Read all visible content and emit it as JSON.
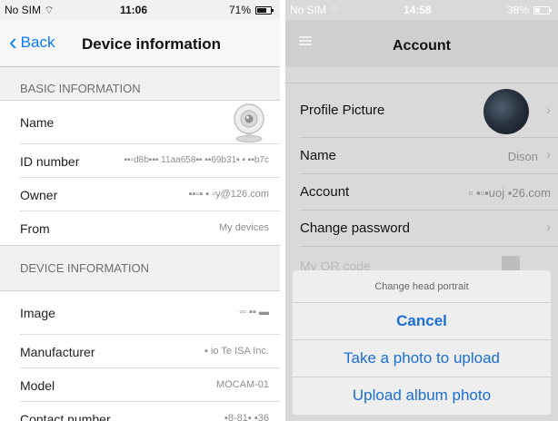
{
  "left": {
    "status": {
      "carrier": "No SIM",
      "time": "11:06",
      "battery_pct": "71%",
      "battery_level": 0.71
    },
    "nav": {
      "back_label": "Back",
      "title": "Device information"
    },
    "basic_header": "BASIC INFORMATION",
    "basic_rows": [
      {
        "label": "Name",
        "value": ""
      },
      {
        "label": "ID number",
        "value": "▪▪▫d8b▪▪▪ 11aa658▪▪ ▪▪69b31▪ ▪ ▪▪b7c"
      },
      {
        "label": "Owner",
        "value": "▪▪▫▪ ▪ ▫y@126.com"
      },
      {
        "label": "From",
        "value": "My devices"
      }
    ],
    "device_header": "DEVICE INFORMATION",
    "device_rows": [
      {
        "label": "Image",
        "value": "▫▫ ▪▪ ▬"
      },
      {
        "label": "Manufacturer",
        "value": "▪   io Te   ISA Inc."
      },
      {
        "label": "Model",
        "value": "MOCAM-01"
      },
      {
        "label": "Contact number",
        "value": "▪8-81▪ ▪36"
      }
    ]
  },
  "right": {
    "status": {
      "carrier": "No SIM",
      "time": "14:58",
      "battery_pct": "38%",
      "battery_level": 0.38
    },
    "nav": {
      "title": "Account"
    },
    "rows": [
      {
        "label": "Profile Picture",
        "value": ""
      },
      {
        "label": "Name",
        "value": "Dison"
      },
      {
        "label": "Account",
        "value": "▫ ▪▫▪uoj  ▪26.com"
      },
      {
        "label": "Change password",
        "value": ""
      }
    ],
    "qr_label": "My QR code",
    "sheet": {
      "title": "Change head portrait",
      "cancel": "Cancel",
      "take_photo": "Take a photo to upload",
      "upload_album": "Upload album photo"
    }
  }
}
